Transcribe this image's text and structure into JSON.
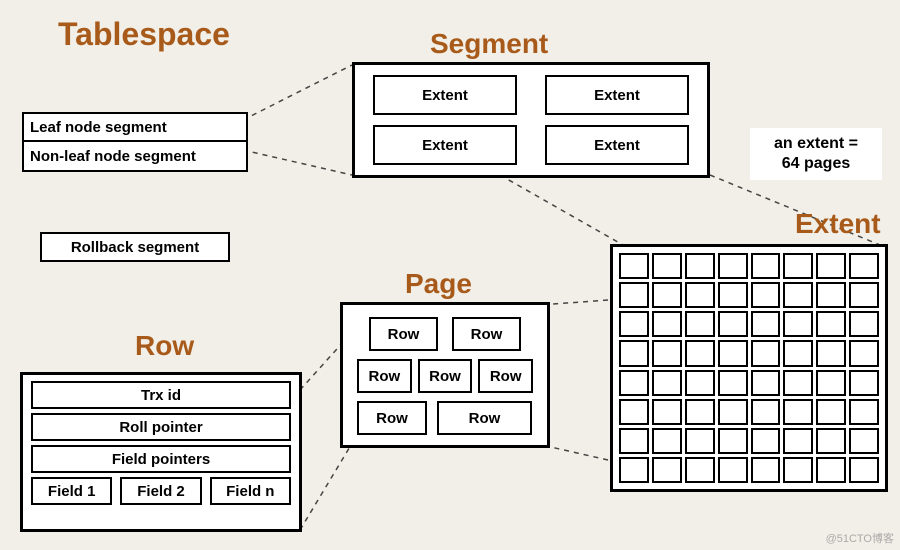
{
  "titles": {
    "tablespace": "Tablespace",
    "segment": "Segment",
    "page": "Page",
    "row": "Row",
    "extent": "Extent"
  },
  "tablespace": {
    "leaf": "Leaf node segment",
    "nonleaf": "Non-leaf node segment",
    "rollback": "Rollback segment"
  },
  "segment": {
    "cells": [
      "Extent",
      "Extent",
      "Extent",
      "Extent"
    ]
  },
  "note": {
    "line1": "an extent =",
    "line2": "64 pages"
  },
  "extent": {
    "grid_cols": 8,
    "grid_rows": 8,
    "page_count": 64
  },
  "page": {
    "rows": [
      "Row",
      "Row",
      "Row",
      "Row",
      "Row",
      "Row",
      "Row"
    ]
  },
  "row": {
    "trx": "Trx id",
    "roll": "Roll pointer",
    "fieldptrs": "Field pointers",
    "fields": [
      "Field 1",
      "Field 2",
      "Field n"
    ]
  },
  "watermark": "@51CTO博客"
}
